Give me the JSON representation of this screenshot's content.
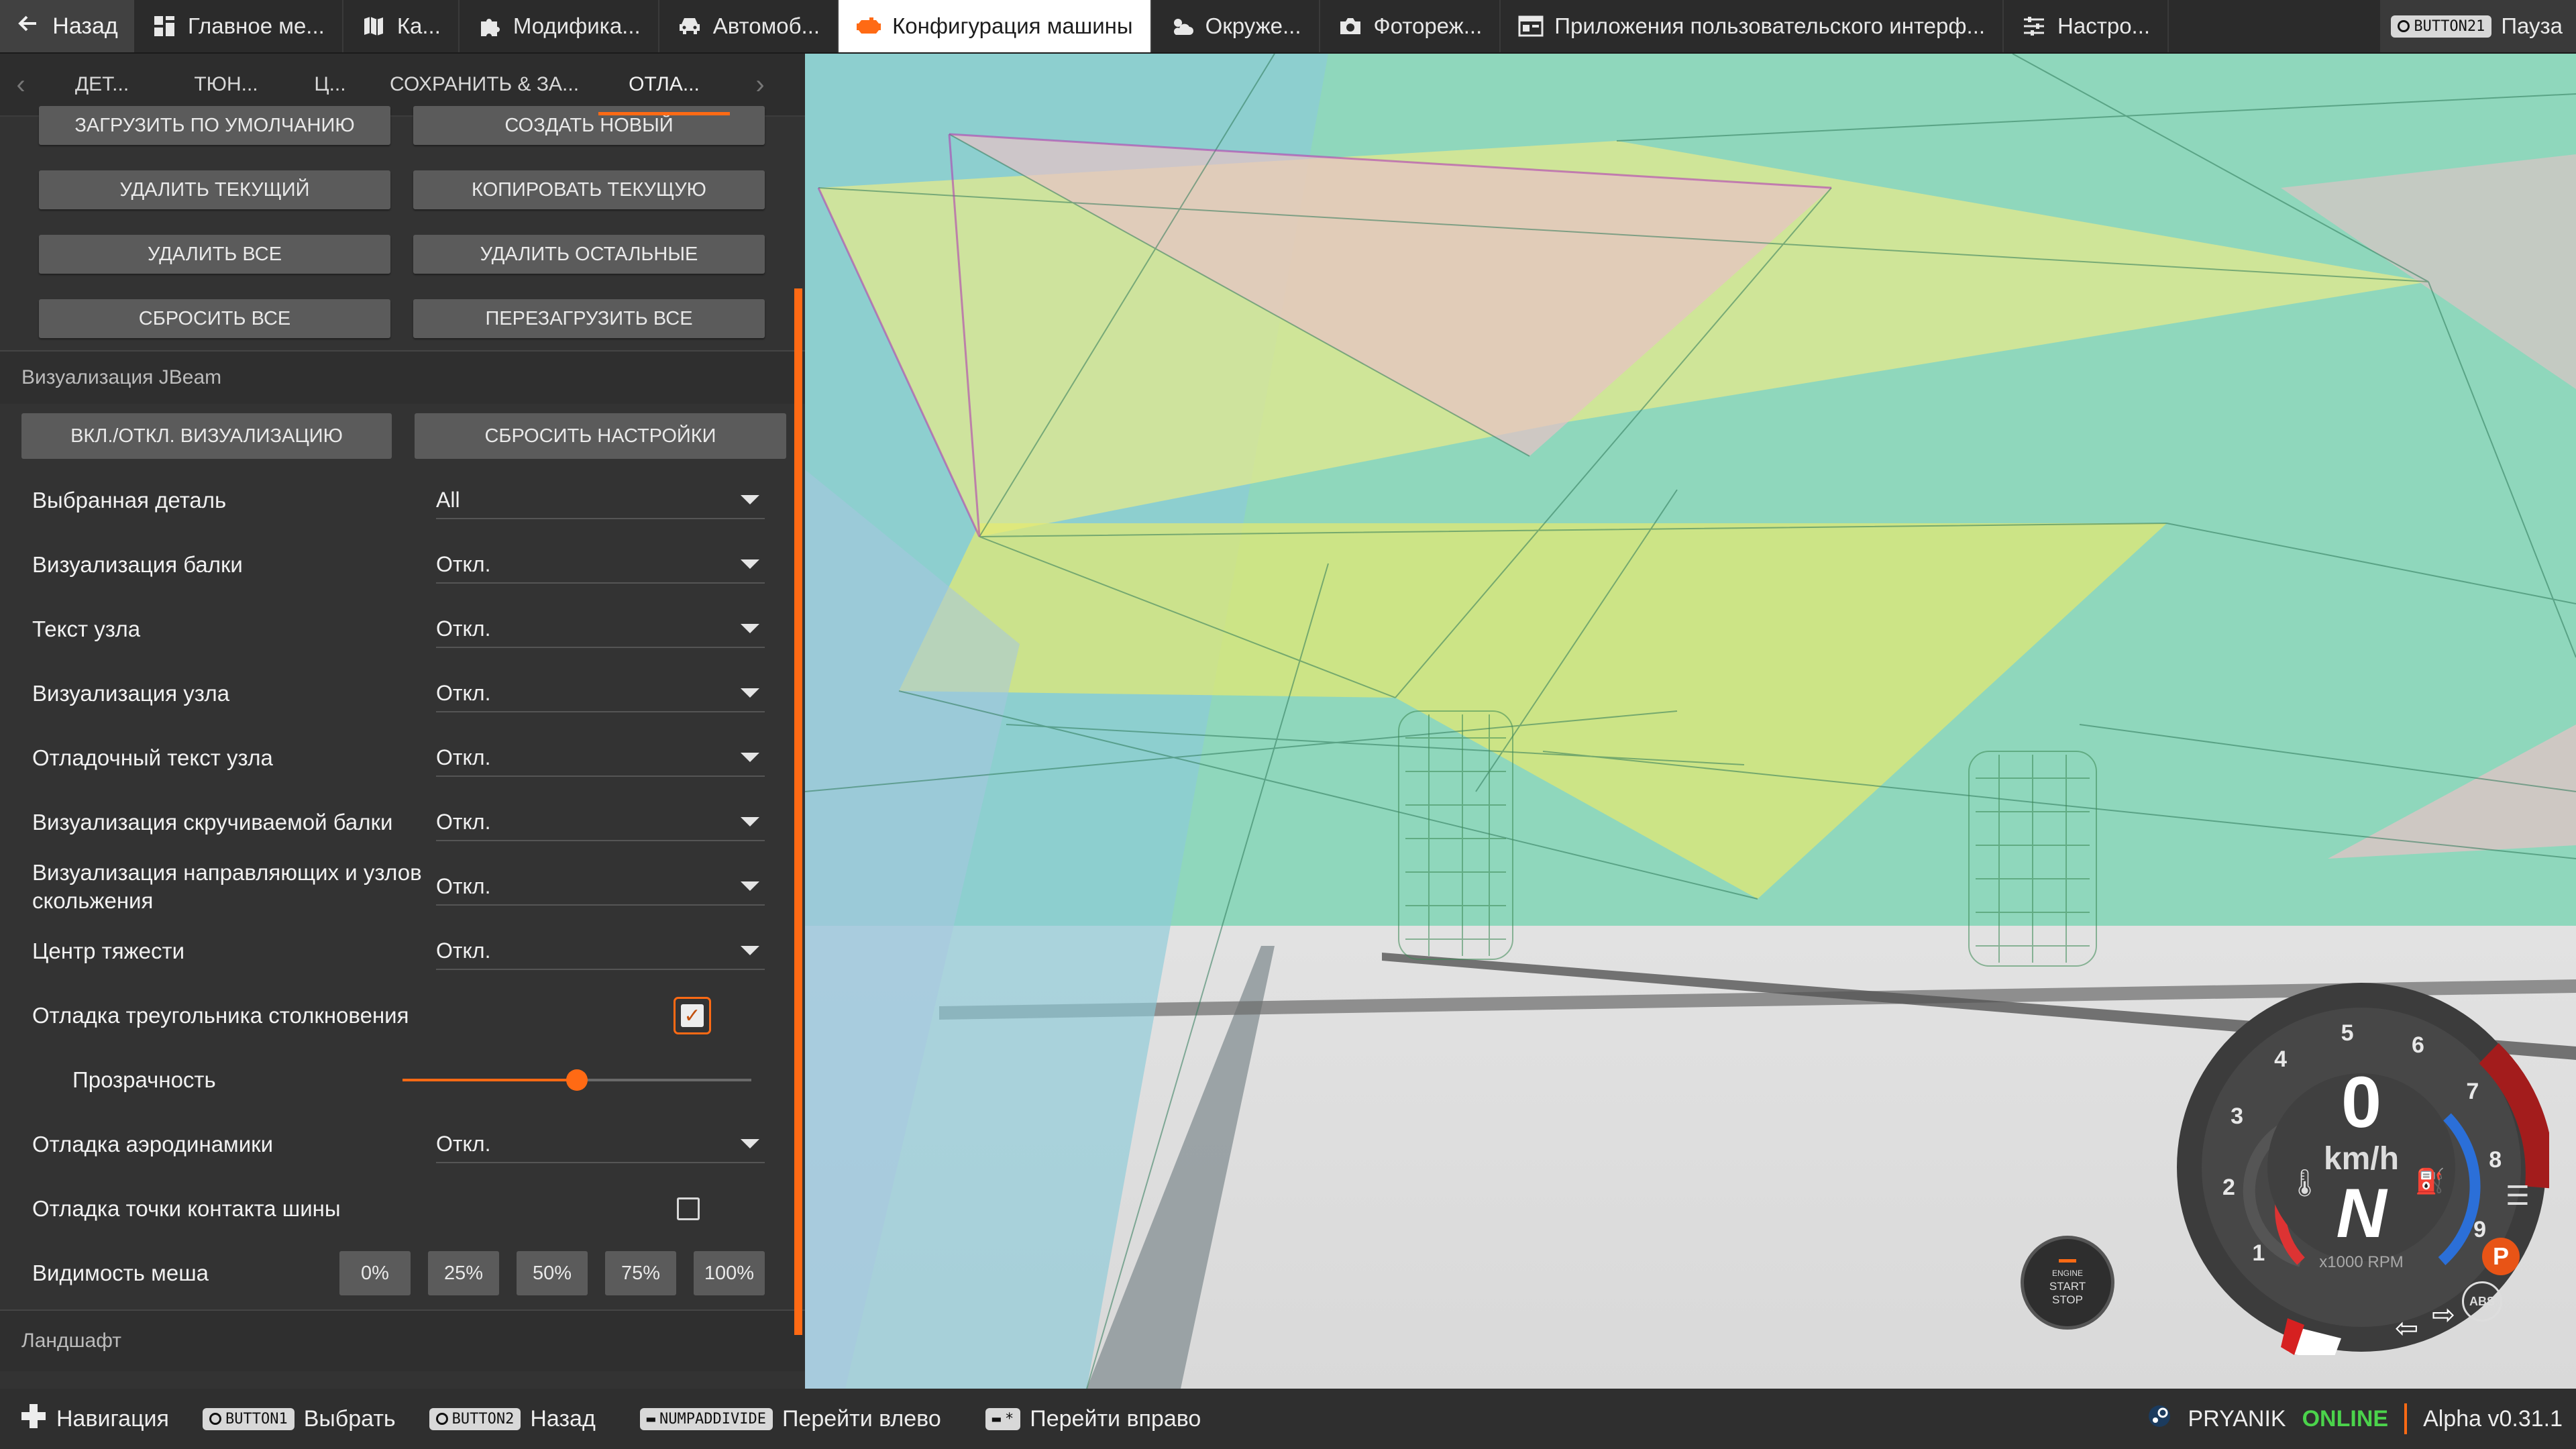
{
  "topbar": {
    "back": "Назад",
    "tabs": [
      {
        "label": "Главное ме...",
        "icon": "dashboard-icon",
        "active": false
      },
      {
        "label": "Ка...",
        "icon": "map-icon",
        "active": false
      },
      {
        "label": "Модифика...",
        "icon": "puzzle-icon",
        "active": false
      },
      {
        "label": "Автомоб...",
        "icon": "car-icon",
        "active": false
      },
      {
        "label": "Конфигурация машины",
        "icon": "engine-icon",
        "active": true
      },
      {
        "label": "Окруже...",
        "icon": "weather-icon",
        "active": false
      },
      {
        "label": "Фотореж...",
        "icon": "camera-icon",
        "active": false
      },
      {
        "label": "Приложения пользовательского интерф...",
        "icon": "ui-apps-icon",
        "active": false
      },
      {
        "label": "Настро...",
        "icon": "sliders-icon",
        "active": false
      }
    ],
    "pause_key": "BUTTON21",
    "pause_label": "Пауза"
  },
  "subtabs": [
    "ДЕТ...",
    "ТЮН...",
    "Ц...",
    "СОХРАНИТЬ & ЗА...",
    "ОТЛА..."
  ],
  "panel": {
    "buttons": [
      [
        "ЗАГРУЗИТЬ ПО УМОЛЧАНИЮ",
        "СОЗДАТЬ НОВЫЙ"
      ],
      [
        "УДАЛИТЬ ТЕКУЩИЙ",
        "КОПИРОВАТЬ ТЕКУЩУЮ"
      ],
      [
        "УДАЛИТЬ ВСЕ",
        "УДАЛИТЬ ОСТАЛЬНЫЕ"
      ],
      [
        "СБРОСИТЬ ВСЕ",
        "ПЕРЕЗАГРУЗИТЬ ВСЕ"
      ]
    ],
    "jbeam_section": "Визуализация JBeam",
    "toggle_vis": "ВКЛ./ОТКЛ. ВИЗУАЛИЗАЦИЮ",
    "reset_settings": "СБРОСИТЬ НАСТРОЙКИ",
    "options": [
      {
        "label": "Выбранная деталь",
        "value": "All"
      },
      {
        "label": "Визуализация балки",
        "value": "Откл."
      },
      {
        "label": "Текст узла",
        "value": "Откл."
      },
      {
        "label": "Визуализация узла",
        "value": "Откл."
      },
      {
        "label": "Отладочный текст узла",
        "value": "Откл."
      },
      {
        "label": "Визуализация скручиваемой балки",
        "value": "Откл."
      },
      {
        "label": "Визуализация направляющих и узлов скольжения",
        "value": "Откл."
      },
      {
        "label": "Центр тяжести",
        "value": "Откл."
      }
    ],
    "collision_debug": {
      "label": "Отладка треугольника столкновения",
      "checked": true,
      "check_glyph": "✓"
    },
    "transparency": {
      "label": "Прозрачность",
      "value": 0.5
    },
    "aero_debug": {
      "label": "Отладка аэродинамики",
      "value": "Откл."
    },
    "tire_contact": {
      "label": "Отладка точки контакта шины",
      "checked": false
    },
    "mesh_visibility": {
      "label": "Видимость меша",
      "options": [
        "0%",
        "25%",
        "50%",
        "75%",
        "100%"
      ]
    },
    "terrain_section": "Ландшафт"
  },
  "gauge": {
    "speed": "0",
    "unit": "km/h",
    "gear": "N",
    "rpm_label": "x1000 RPM",
    "rpm_ticks": [
      "1",
      "2",
      "3",
      "4",
      "5",
      "6",
      "7",
      "8",
      "9"
    ],
    "park": "P",
    "abs": "ABS",
    "engine_btn": [
      "ENGINE",
      "START",
      "STOP"
    ]
  },
  "bottombar": {
    "nav": "Навигация",
    "select_key": "BUTTON1",
    "select": "Выбрать",
    "back_key": "BUTTON2",
    "back": "Назад",
    "left_key": "NUMPADDIVIDE",
    "left": "Перейти влево",
    "right_key": "*",
    "right": "Перейти вправо",
    "user": "PRYANIK",
    "online": "ONLINE",
    "version": "Alpha v0.31.1"
  },
  "colors": {
    "accent": "#ff6a14",
    "online": "#4bd34b",
    "panel": "#333333"
  }
}
